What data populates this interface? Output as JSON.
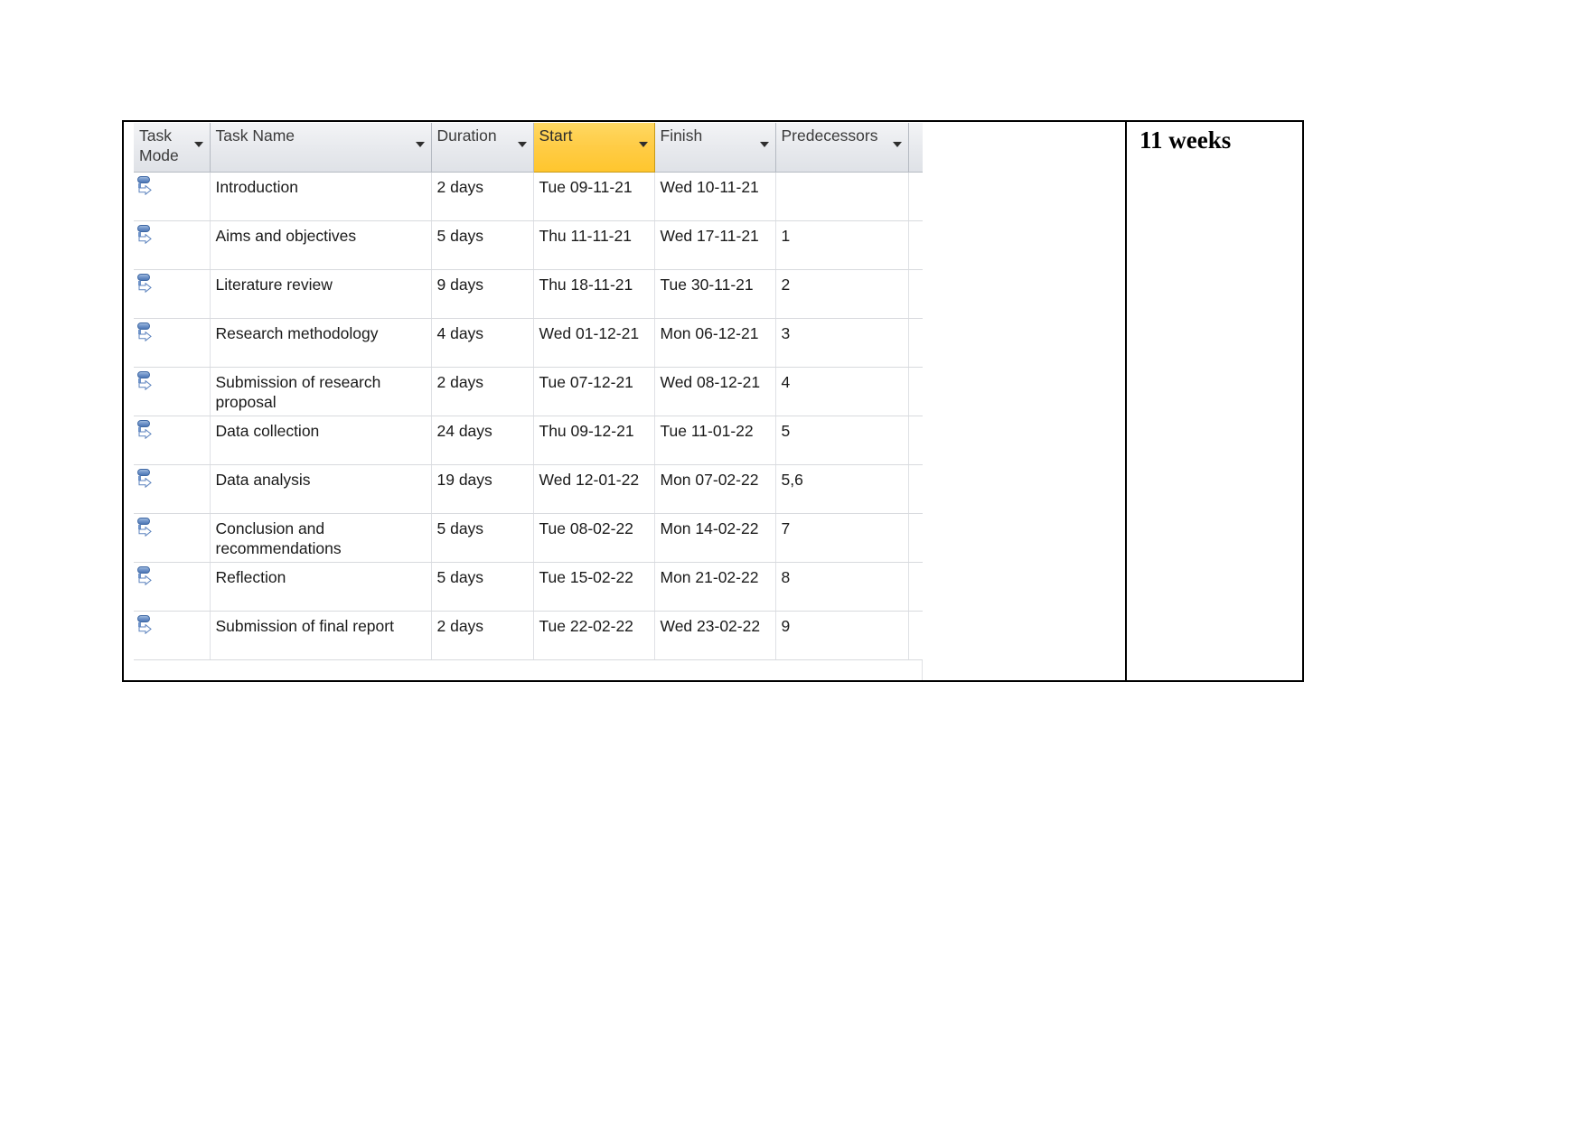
{
  "document": {
    "side_note": "11 weeks"
  },
  "project_table": {
    "columns": [
      {
        "key": "task_mode",
        "label": "Task Mode",
        "has_sort_caret": true,
        "selected": false
      },
      {
        "key": "task_name",
        "label": "Task Name",
        "has_sort_caret": true,
        "selected": false
      },
      {
        "key": "duration",
        "label": "Duration",
        "has_sort_caret": true,
        "selected": false
      },
      {
        "key": "start",
        "label": "Start",
        "has_sort_caret": true,
        "selected": true
      },
      {
        "key": "finish",
        "label": "Finish",
        "has_sort_caret": true,
        "selected": false
      },
      {
        "key": "predecessors",
        "label": "Predecessors",
        "has_sort_caret": true,
        "selected": false
      },
      {
        "key": "clipped",
        "label": "",
        "has_sort_caret": false,
        "selected": false
      }
    ],
    "selected_column": "Start",
    "selected_column_color": "#ffcc45",
    "task_mode_icon": "manually-scheduled-icon",
    "rows": [
      {
        "mode": "manually-scheduled-icon",
        "name": "Introduction",
        "duration": "2 days",
        "start": "Tue 09-11-21",
        "finish": "Wed 10-11-21",
        "predecessors": "",
        "lines": 1
      },
      {
        "mode": "manually-scheduled-icon",
        "name": "Aims and objectives",
        "duration": "5 days",
        "start": "Thu 11-11-21",
        "finish": "Wed 17-11-21",
        "predecessors": "1",
        "lines": 1
      },
      {
        "mode": "manually-scheduled-icon",
        "name": "Literature review",
        "duration": "9 days",
        "start": "Thu 18-11-21",
        "finish": "Tue 30-11-21",
        "predecessors": "2",
        "lines": 1
      },
      {
        "mode": "manually-scheduled-icon",
        "name": "Research methodology",
        "duration": "4 days",
        "start": "Wed 01-12-21",
        "finish": "Mon 06-12-21",
        "predecessors": "3",
        "lines": 1
      },
      {
        "mode": "manually-scheduled-icon",
        "name": "Submission of research proposal",
        "duration": "2 days",
        "start": "Tue 07-12-21",
        "finish": "Wed 08-12-21",
        "predecessors": "4",
        "lines": 2
      },
      {
        "mode": "manually-scheduled-icon",
        "name": "Data collection",
        "duration": "24 days",
        "start": "Thu 09-12-21",
        "finish": "Tue 11-01-22",
        "predecessors": "5",
        "lines": 1
      },
      {
        "mode": "manually-scheduled-icon",
        "name": "Data analysis",
        "duration": "19 days",
        "start": "Wed 12-01-22",
        "finish": "Mon 07-02-22",
        "predecessors": "5,6",
        "lines": 1
      },
      {
        "mode": "manually-scheduled-icon",
        "name": "Conclusion and recommendations",
        "duration": "5 days",
        "start": "Tue 08-02-22",
        "finish": "Mon 14-02-22",
        "predecessors": "7",
        "lines": 2
      },
      {
        "mode": "manually-scheduled-icon",
        "name": "Reflection",
        "duration": "5 days",
        "start": "Tue 15-02-22",
        "finish": "Mon 21-02-22",
        "predecessors": "8",
        "lines": 1
      },
      {
        "mode": "manually-scheduled-icon",
        "name": "Submission of final report",
        "duration": "2 days",
        "start": "Tue 22-02-22",
        "finish": "Wed 23-02-22",
        "predecessors": "9",
        "lines": 1
      }
    ]
  }
}
